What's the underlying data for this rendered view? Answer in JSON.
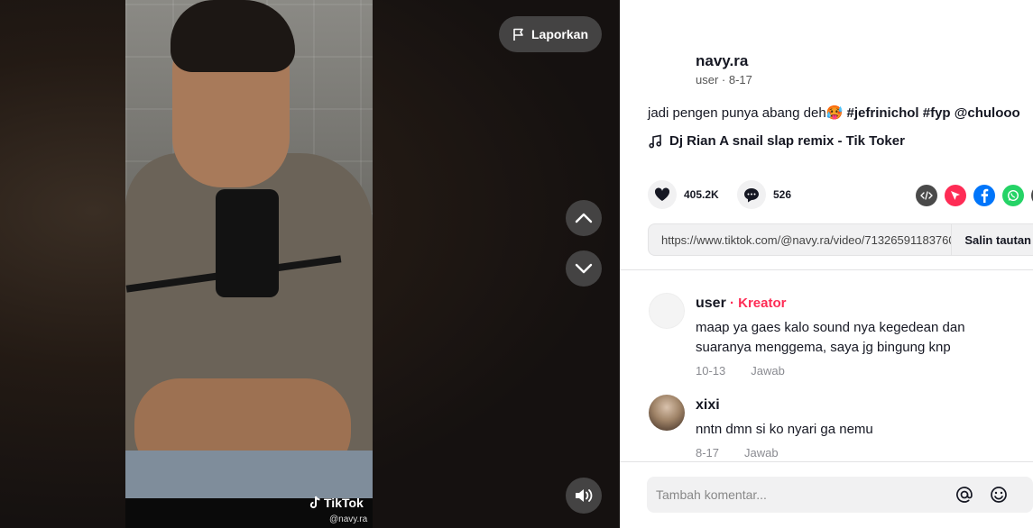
{
  "video": {
    "report_label": "Laporkan",
    "watermark_brand": "TikTok",
    "watermark_user": "@navy.ra",
    "icons": {
      "report": "flag-icon",
      "prev": "chevron-up-icon",
      "next": "chevron-down-icon",
      "volume": "volume-icon"
    }
  },
  "post": {
    "username": "navy.ra",
    "meta": "user · 8-17",
    "description_text": "jadi pengen punya abang deh",
    "emoji": "🥵",
    "hashtags": [
      "#jefrinichol",
      "#fyp",
      "@chulooo"
    ],
    "music_title": "Dj Rian A snail slap remix - Tik Toker",
    "likes": "405.2K",
    "comments": "526",
    "link": "https://www.tiktok.com/@navy.ra/video/71326591183760...",
    "copy_label": "Salin tautan",
    "share_colors": {
      "embed": "#4a4a4a",
      "send": "#fe2c55",
      "facebook": "#0075fa",
      "whatsapp": "#25d366"
    }
  },
  "comments": [
    {
      "name": "user",
      "badge_sep": " · ",
      "badge": "Kreator",
      "text": "maap ya gaes kalo sound nya kegedean dan suaranya menggema, saya jg bingung knp",
      "date": "10-13",
      "reply": "Jawab"
    },
    {
      "name": "xixi",
      "text": "nntn dmn si ko nyari ga nemu",
      "date": "8-17",
      "reply": "Jawab"
    }
  ],
  "composer": {
    "placeholder": "Tambah komentar...",
    "icons": {
      "mention": "at-sign-icon",
      "emoji": "emoji-icon"
    }
  }
}
